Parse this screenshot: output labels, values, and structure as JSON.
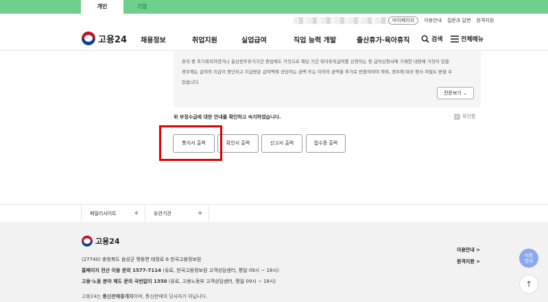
{
  "tabs": [
    {
      "label": "개인",
      "active": true
    },
    {
      "label": "기업",
      "active": false
    }
  ],
  "util": {
    "mypage": "마이페이지",
    "links": [
      "이용안내",
      "질문과 답변",
      "원격지원"
    ]
  },
  "gnb": {
    "logo": "고용24",
    "menu": [
      "채용정보",
      "취업지원",
      "실업급여",
      "직업 능력 개발",
      "출산휴가·육아휴직"
    ],
    "search": "검색",
    "all_menu": "전체메뉴"
  },
  "notice": {
    "lines": [
      "휴직 중 조기복직하였거나 출산전후휴가기간 중임에도 거짓으로 해당 기간 육아휴직급여를 신청하는 등 급여신청서에 기재한 내용에 거짓이 있을",
      "경우에는 급여의 지급이 중단되고 지급받은 급여액에 상당하는 금액 또는 이하의 금액을 추가로 반환하여야 하며, 경우에 따라 형사 처벌도 받을 수",
      "있습니다."
    ],
    "detail_button": "전문보기"
  },
  "confirm": {
    "text": "위 부정수급에 대한 안내를 확인하고 숙지하였습니다.",
    "checkbox_label": "확인함",
    "checked": true
  },
  "actions": [
    "통지서 출력",
    "확인서 출력",
    "신고서 출력",
    "접수증 출력"
  ],
  "family": {
    "sites": "패밀리사이트",
    "orgs": "유관기관"
  },
  "footer": {
    "logo": "고용24",
    "address": "(27740) 충청북도 음성군 맹동면 태정로 6 한국고용정보원",
    "line1_label": "홈페이지 전산 이용 문의 1577-7114",
    "line1_rest": " (유료, 한국고용정보원 고객상담센터, 평일 09시 ~ 18시)",
    "line2_label": "고용·노동 분야 제도 문의 국번없이 1350",
    "line2_rest": " (유료, 고용노동부 고객상담센터, 평일 09시 ~ 18시)",
    "line3_pre": "고용24는 ",
    "line3_bold": "통신판매중개자",
    "line3_post": "이며, 통신판매의 당사자가 아닙니다.",
    "links": [
      "이용안내 >",
      "원격지원 >"
    ]
  },
  "fab": {
    "use_guide": "이용\n안내",
    "top": "↑"
  }
}
